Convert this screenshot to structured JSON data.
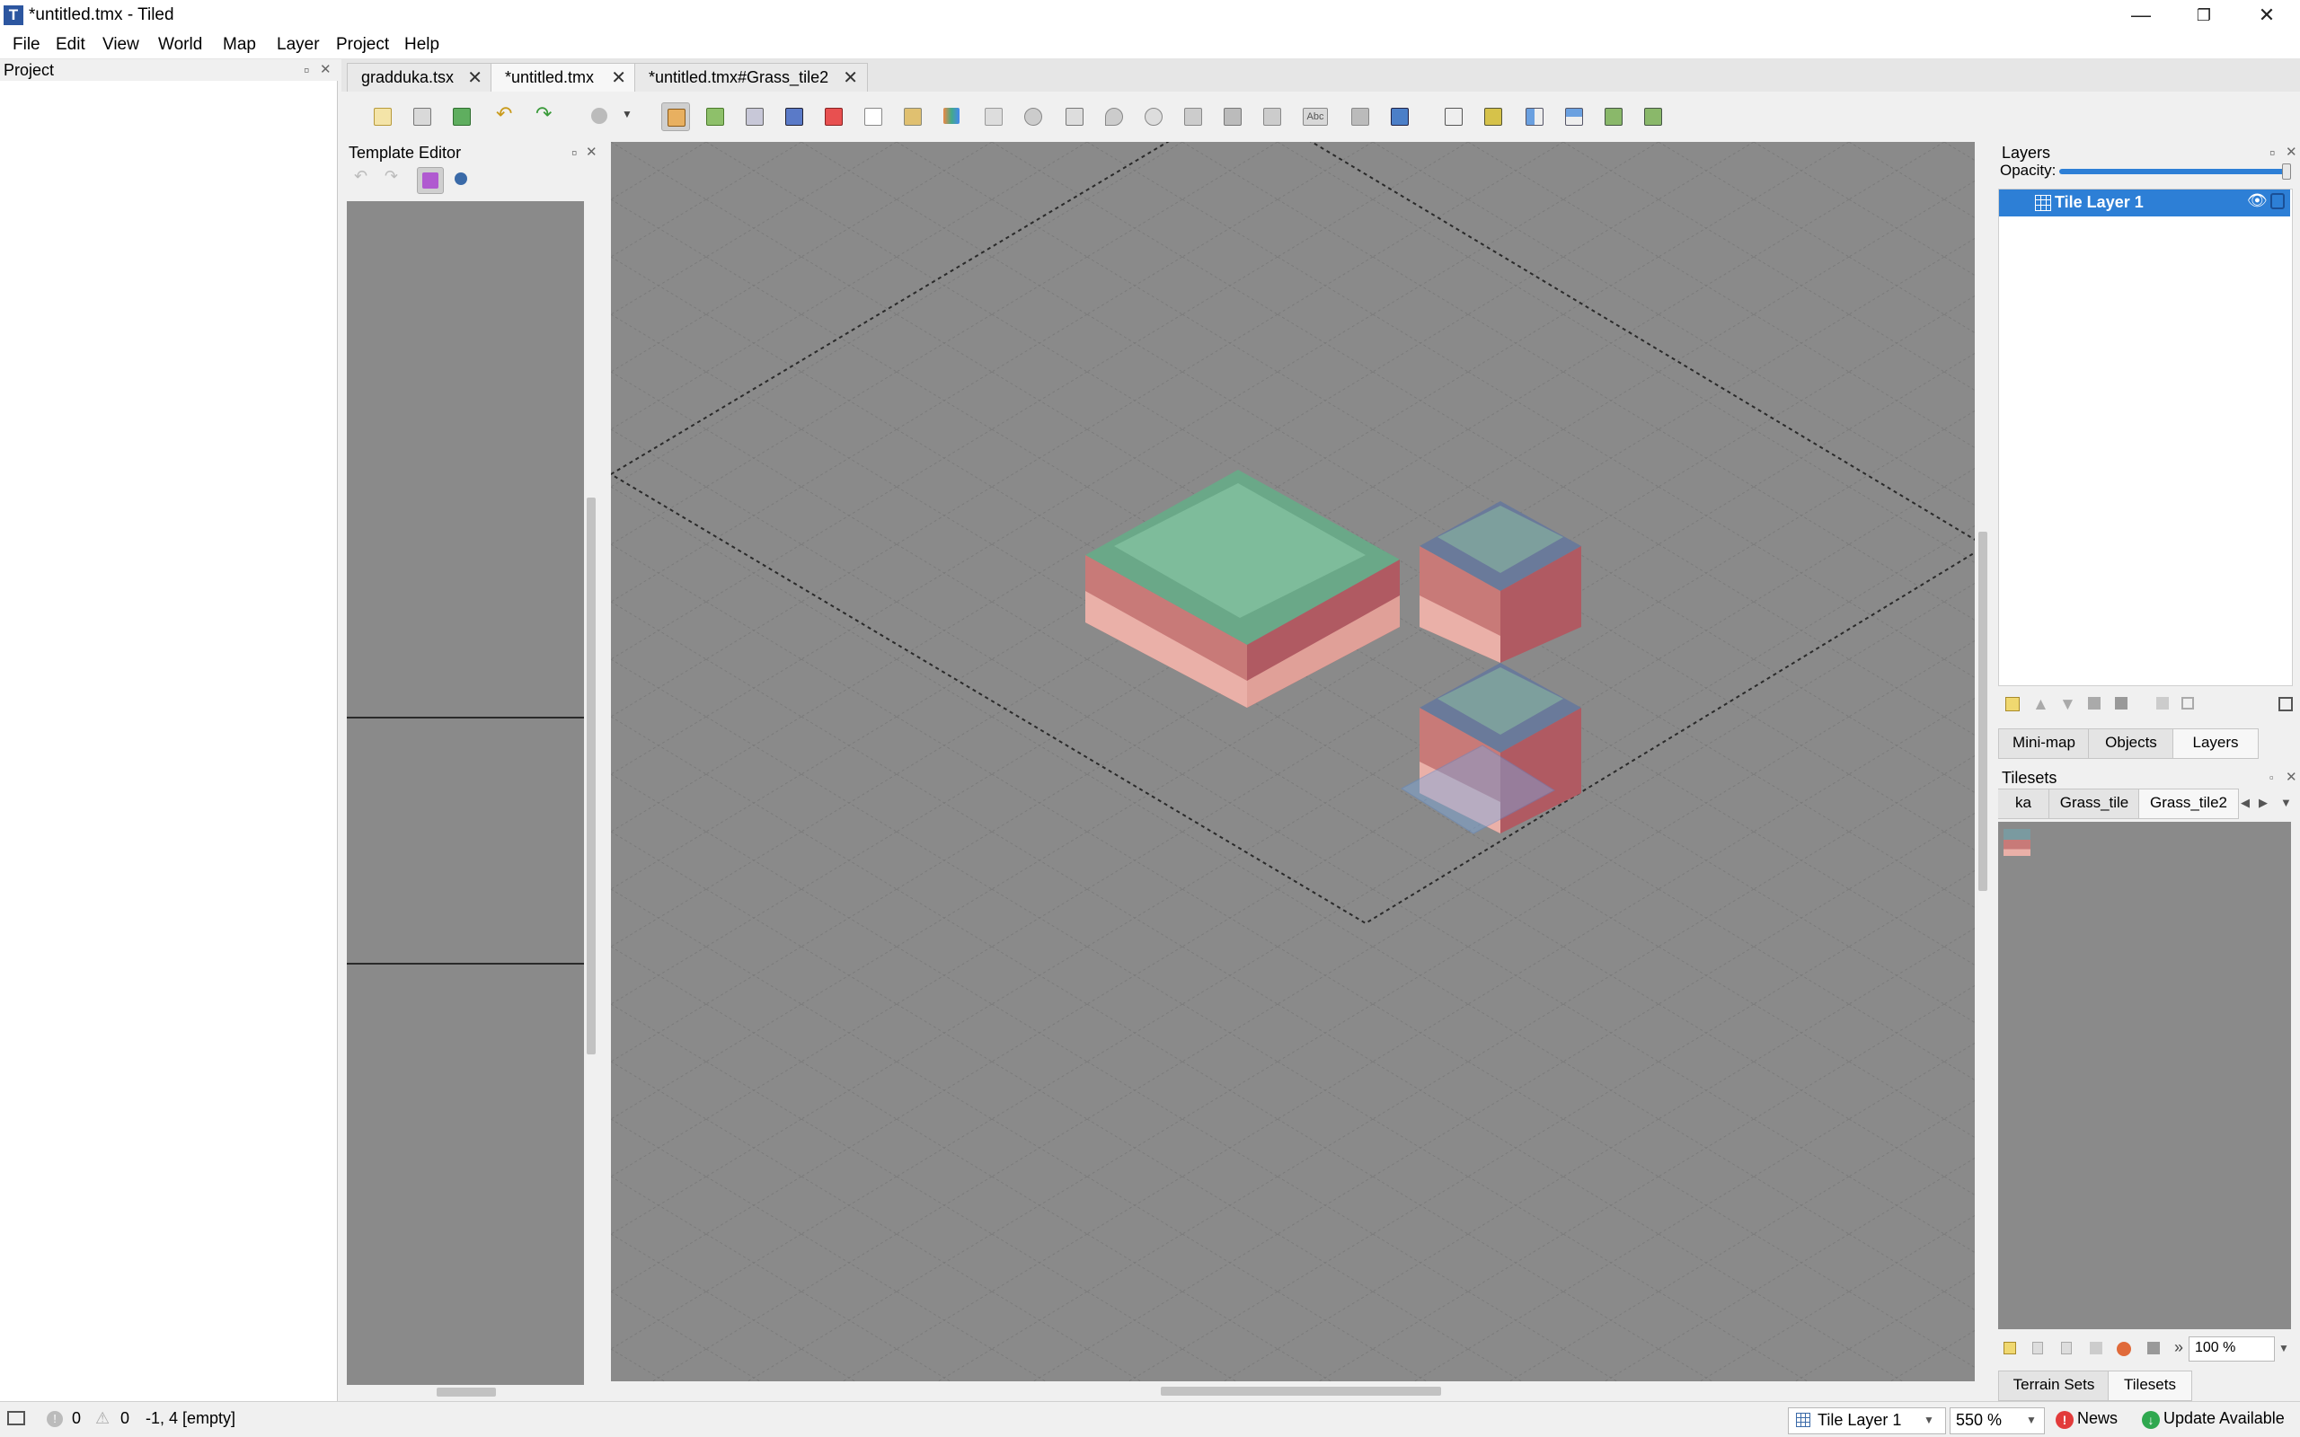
{
  "window": {
    "title": "*untitled.tmx - Tiled",
    "app_icon_letter": "T",
    "controls": [
      "—",
      "❐",
      "✕"
    ]
  },
  "menu": [
    "File",
    "Edit",
    "View",
    "World",
    "Map",
    "Layer",
    "Project",
    "Help"
  ],
  "project_panel": {
    "title": "Project"
  },
  "doc_tabs": [
    {
      "label": "gradduka.tsx",
      "active": false
    },
    {
      "label": "*untitled.tmx",
      "active": true
    },
    {
      "label": "*untitled.tmx#Grass_tile2",
      "active": false
    }
  ],
  "template_editor": {
    "title": "Template Editor"
  },
  "layers_panel": {
    "title": "Layers",
    "opacity_label": "Opacity:",
    "opacity": 1.0,
    "layers": [
      {
        "name": "Tile Layer 1",
        "visible": true,
        "selected": true
      }
    ]
  },
  "panel_tabs": [
    "Mini-map",
    "Objects",
    "Layers"
  ],
  "panel_tabs_active": "Layers",
  "tilesets_panel": {
    "title": "Tilesets",
    "tabs": [
      "ka",
      "Grass_tile",
      "Grass_tile2"
    ],
    "active_tab": "Grass_tile2",
    "zoom": "100 %"
  },
  "bottom_tabs": [
    "Terrain Sets",
    "Tilesets"
  ],
  "status": {
    "errors": "0",
    "warnings": "0",
    "position": "-1, 4 [empty]",
    "layer": "Tile Layer 1",
    "zoom": "550 %",
    "news": "News",
    "update": "Update Available"
  },
  "colors": {
    "accent": "#2d7fd6",
    "canvas": "#8a8a8a",
    "error": "#e23b3b",
    "update": "#2fa84f"
  }
}
